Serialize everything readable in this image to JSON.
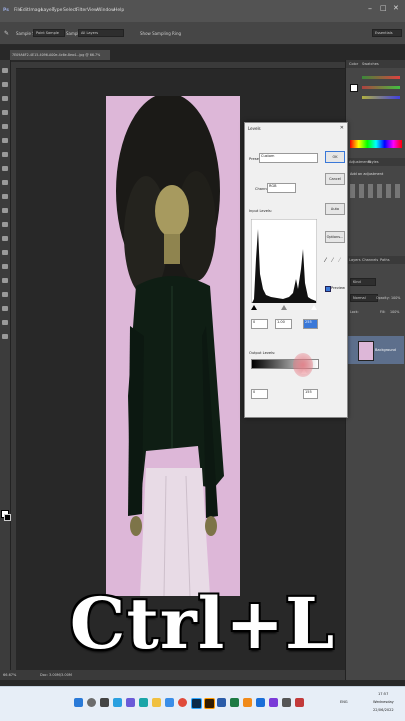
{
  "menu": [
    "Ps",
    "File",
    "Edit",
    "Image",
    "Layer",
    "Type",
    "Select",
    "Filter",
    "View",
    "Window",
    "Help"
  ],
  "options": {
    "sample_size_label": "Sample Size:",
    "sample_size_value": "Point Sample",
    "sample_label": "Sample:",
    "sample_value": "All Layers",
    "show_ring": "Show Sampling Ring",
    "workspace": "Essentials"
  },
  "document_tab": "7E09A6F2-4E15-4096-A00e-4c6e-8ea4...jpg @ 66.7% (RGB/8#) *",
  "status": {
    "zoom": "66.67%",
    "doc": "Doc: 3.00M/3.00M"
  },
  "levels": {
    "title": "Levels",
    "preset_label": "Preset:",
    "preset_value": "Custom",
    "channel_label": "Channel:",
    "channel_value": "RGB",
    "input_label": "Input Levels:",
    "input_values": [
      "0",
      "1.00",
      "255"
    ],
    "output_label": "Output Levels:",
    "output_values": [
      "0",
      "155"
    ],
    "buttons": {
      "ok": "OK",
      "cancel": "Cancel",
      "auto": "Auto",
      "options": "Options...",
      "preview": "Preview"
    }
  },
  "panels": {
    "color_tab": "Color",
    "swatches_tab": "Swatches",
    "adjustments_tab": "Adjustments",
    "styles_tab": "Styles",
    "add_adjustment": "Add an adjustment",
    "layers_tab": "Layers",
    "channels_tab": "Channels",
    "paths_tab": "Paths",
    "kind": "Kind",
    "normal": "Normal",
    "opacity_label": "Opacity:",
    "opacity_value": "100%",
    "lock_label": "Lock:",
    "fill_label": "Fill:",
    "fill_value": "100%",
    "layer_name": "Background"
  },
  "taskbar": {
    "time": "17:57",
    "day": "Wednesday",
    "date": "22/06/2022",
    "lang": "ENG"
  },
  "overlay_text": "Ctrl+L",
  "colors": {
    "canvas_bg": "#ddb7d8",
    "accent": "#3a78d8"
  }
}
